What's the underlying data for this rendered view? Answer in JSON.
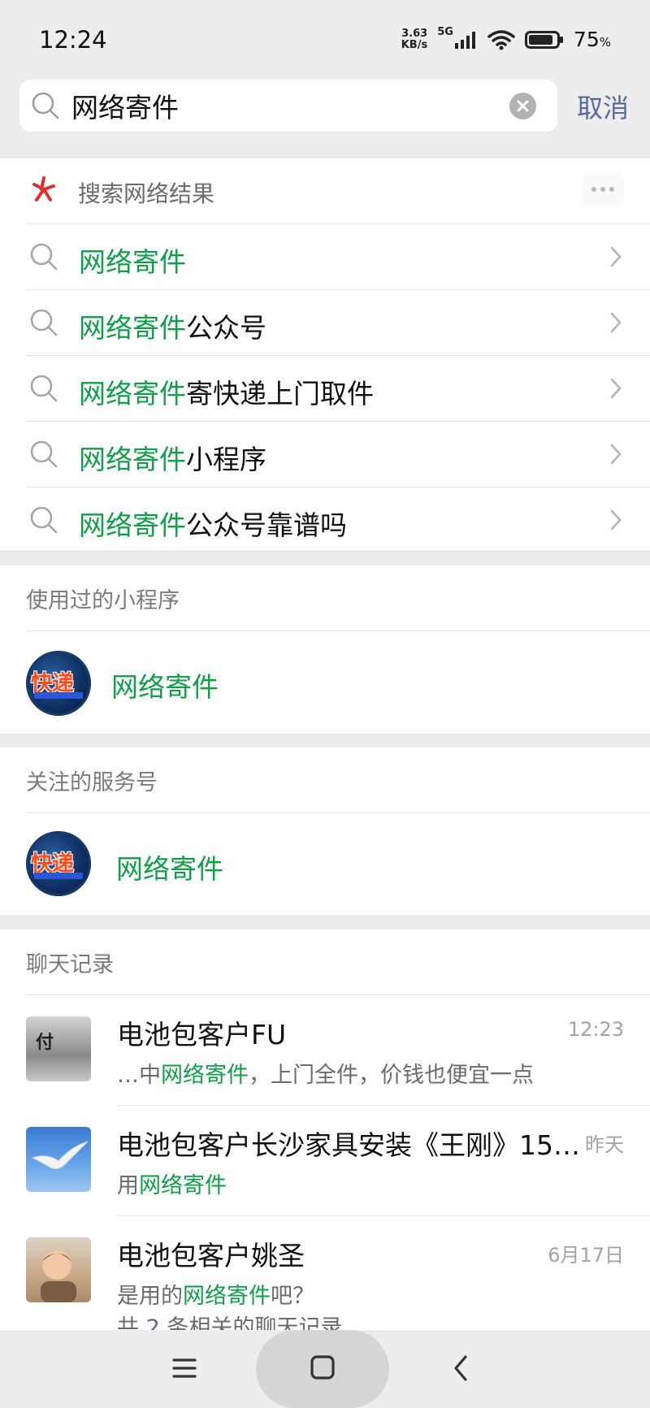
{
  "status_bar": {
    "time": "12:24",
    "net_speed_value": "3.63",
    "net_speed_unit": "KB/s",
    "network_type": "5G",
    "battery_percent": "75"
  },
  "search": {
    "query": "网络寄件",
    "placeholder": "",
    "cancel_label": "取消"
  },
  "web_results": {
    "header": "搜索网络结果",
    "suggestions": [
      {
        "highlight": "网络寄件",
        "rest": ""
      },
      {
        "highlight": "网络寄件",
        "rest": "公众号"
      },
      {
        "highlight": "网络寄件",
        "rest": "寄快递上门取件"
      },
      {
        "highlight": "网络寄件",
        "rest": "小程序"
      },
      {
        "highlight": "网络寄件",
        "rest": "公众号靠谱吗"
      }
    ]
  },
  "mini_programs": {
    "header": "使用过的小程序",
    "items": [
      {
        "name": "网络寄件",
        "logo_text": "快递"
      }
    ]
  },
  "service_accounts": {
    "header": "关注的服务号",
    "items": [
      {
        "name": "网络寄件",
        "logo_text": "快递"
      }
    ]
  },
  "chat_records": {
    "header": "聊天记录",
    "items": [
      {
        "title": "电池包客户FU",
        "time": "12:23",
        "snippet_before": "…中",
        "snippet_highlight": "网络寄件",
        "snippet_after": "，上门全件，价钱也便宜一点",
        "avatar_text": "付"
      },
      {
        "title": "电池包客户长沙家具安装《王刚》15…",
        "time": "昨天",
        "snippet_before": "用",
        "snippet_highlight": "网络寄件",
        "snippet_after": ""
      },
      {
        "title": "电池包客户姚圣",
        "time": "6月17日",
        "snippet_before": "是用的",
        "snippet_highlight": "网络寄件",
        "snippet_after": "吧？"
      }
    ],
    "more_before": "共",
    "more_count": "2",
    "more_after": "条相关的聊天记录"
  },
  "colors": {
    "highlight": "#0e9f48",
    "link_blue": "#576b95",
    "background": "#ededed"
  }
}
